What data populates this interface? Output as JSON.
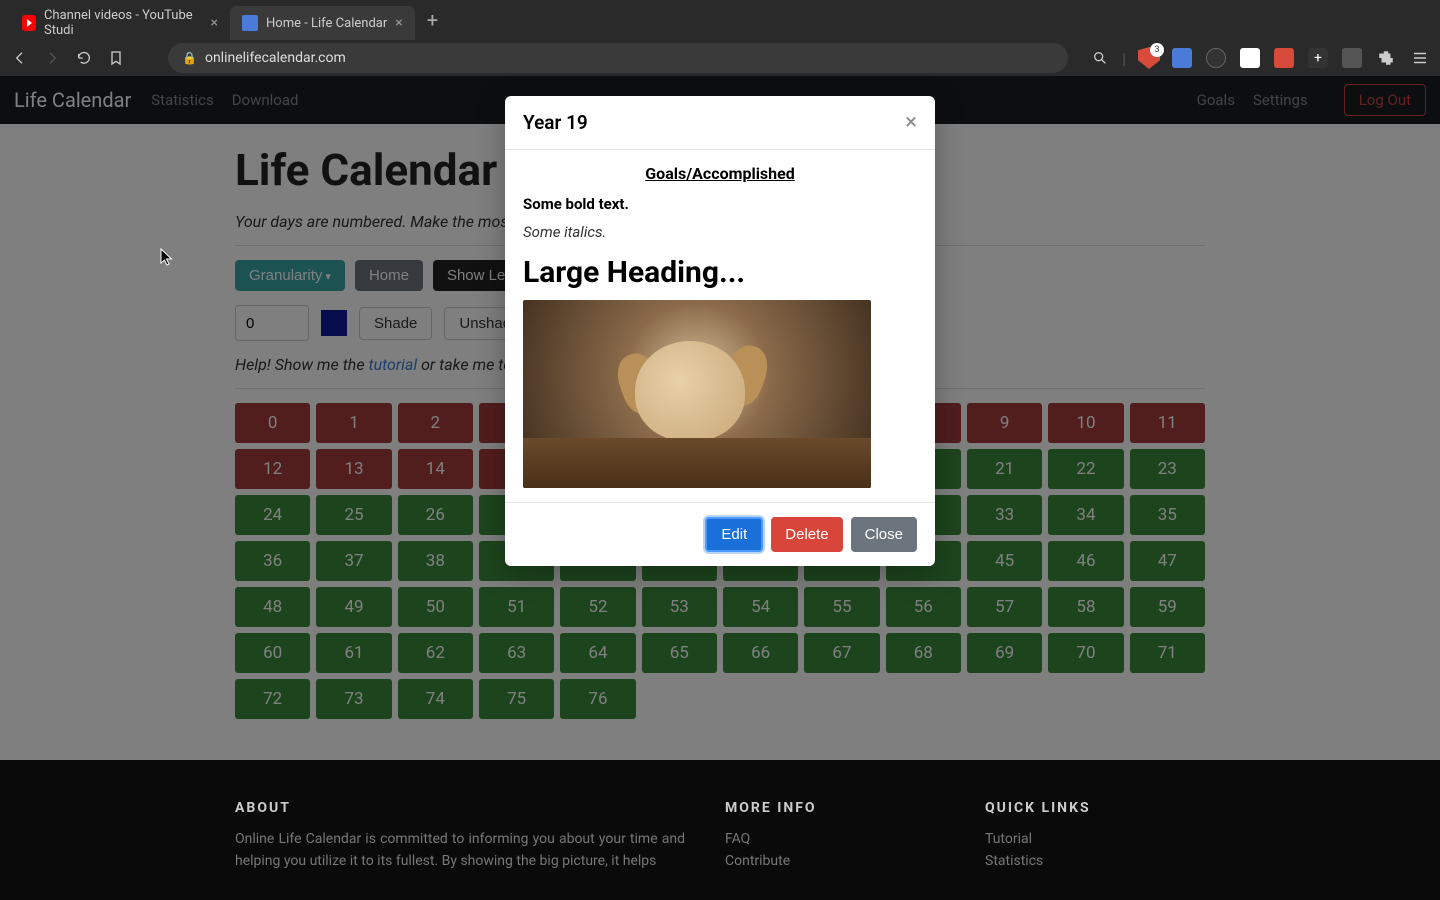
{
  "browser": {
    "tabs": [
      {
        "title": "Channel videos - YouTube Studi",
        "active": false
      },
      {
        "title": "Home - Life Calendar",
        "active": true
      }
    ],
    "url": "onlinelifecalendar.com",
    "shield_count": "3"
  },
  "nav": {
    "brand": "Life Calendar",
    "links": [
      "Statistics",
      "Download"
    ],
    "right_links": [
      "Goals",
      "Settings"
    ],
    "logout": "Log Out"
  },
  "page": {
    "heading": "Life Calendar",
    "tagline": "Your days are numbered. Make the most of them.",
    "granularity": "Granularity",
    "home": "Home",
    "show_legend": "Show Legend",
    "num_value": "0",
    "shade": "Shade",
    "unshade": "Unshade",
    "help_prefix": "Help! Show me the ",
    "help_link": "tutorial",
    "help_suffix": " or take me to the homepage."
  },
  "grid": {
    "red_end": 20,
    "total": 77
  },
  "modal": {
    "title": "Year 19",
    "goals": "Goals/Accomplished",
    "bold": "Some bold text.",
    "italics": "Some italics.",
    "heading": "Large Heading...",
    "edit": "Edit",
    "delete": "Delete",
    "close": "Close"
  },
  "footer": {
    "about_h": "ABOUT",
    "about_p": "Online Life Calendar is committed to informing you about your time and helping you utilize it to its fullest. By showing the big picture, it helps",
    "more_h": "MORE INFO",
    "more_links": [
      "FAQ",
      "Contribute"
    ],
    "quick_h": "QUICK LINKS",
    "quick_links": [
      "Tutorial",
      "Statistics"
    ]
  }
}
